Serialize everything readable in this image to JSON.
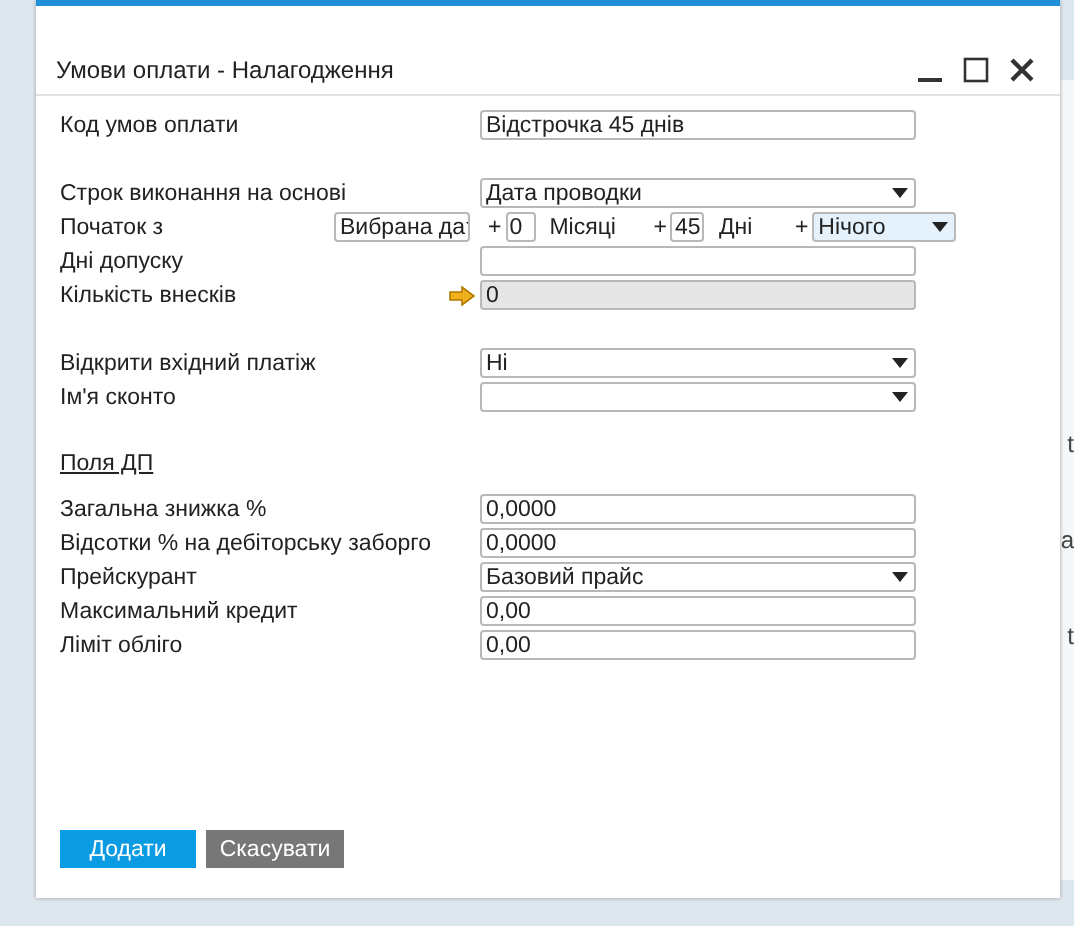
{
  "window": {
    "title": "Умови оплати - Налагодження"
  },
  "background_texts": [
    "t",
    "a",
    "t"
  ],
  "sections": [
    {
      "rows": [
        {
          "kind": "text",
          "label": "Код умов оплати",
          "value": "Відстрочка 45 днів"
        }
      ]
    },
    {
      "rows": [
        {
          "kind": "select",
          "label": "Строк виконання на основі",
          "value": "Дата проводки"
        },
        {
          "kind": "start",
          "label": "Початок з",
          "base": "Вибрана да",
          "plus": [
            "+",
            "+",
            "+"
          ],
          "months": "0",
          "months_label": "Місяці",
          "days": "45",
          "days_label": "Дні",
          "extra": "Нічого",
          "extra_focused": true
        },
        {
          "kind": "text",
          "label": "Дні допуску",
          "value": ""
        },
        {
          "kind": "linked",
          "label": "Кількість внесків",
          "value": "0",
          "disabled": true
        }
      ]
    },
    {
      "rows": [
        {
          "kind": "select",
          "label": "Відкрити вхідний платіж",
          "value": "Ні"
        },
        {
          "kind": "select",
          "label": "Ім'я сконто",
          "value": ""
        }
      ]
    },
    {
      "heading": "Поля ДП",
      "rows": [
        {
          "kind": "text",
          "label": "Загальна знижка %",
          "value": "0,0000"
        },
        {
          "kind": "text",
          "label": "Відсотки % на дебіторську заборго",
          "value": "0,0000"
        },
        {
          "kind": "select",
          "label": "Прейскурант",
          "value": "Базовий прайс"
        },
        {
          "kind": "text",
          "label": "Максимальний кредит",
          "value": "0,00"
        },
        {
          "kind": "text",
          "label": "Ліміт обліго",
          "value": "0,00"
        }
      ]
    }
  ],
  "buttons": [
    {
      "label": "Додати",
      "kind": "primary"
    },
    {
      "label": "Скасувати",
      "kind": "secondary"
    }
  ]
}
